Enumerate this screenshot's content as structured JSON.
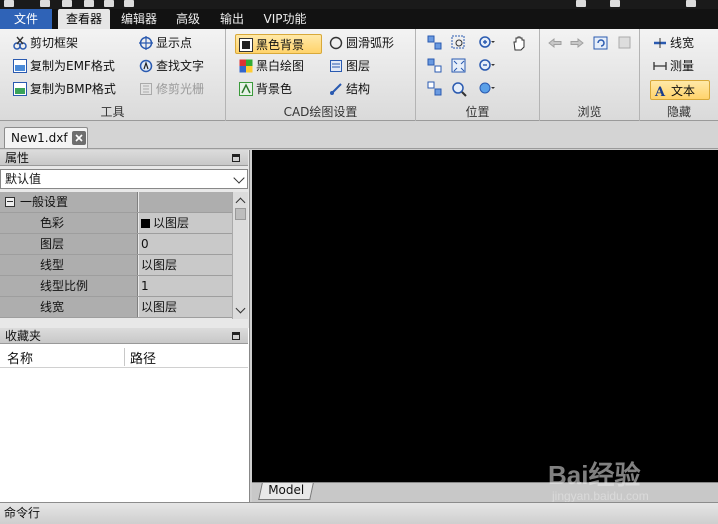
{
  "menu": {
    "file": "文件",
    "viewer": "查看器",
    "editor": "编辑器",
    "advanced": "高级",
    "output": "输出",
    "vip": "VIP功能"
  },
  "ribbon": {
    "tools": {
      "label": "工具",
      "clip_frame": "剪切框架",
      "copy_emf": "复制为EMF格式",
      "copy_bmp": "复制为BMP格式",
      "show_points": "显示点",
      "find_text": "查找文字",
      "trim_raster": "修剪光栅"
    },
    "cad_settings": {
      "label": "CAD绘图设置",
      "black_background": "黑色背景",
      "black_white": "黑白绘图",
      "background_color": "背景色",
      "smooth_arc": "圆滑弧形",
      "layers": "图层",
      "structure": "结构"
    },
    "position": {
      "label": "位置"
    },
    "browse": {
      "label": "浏览"
    },
    "hide": {
      "label": "隐藏",
      "line_width": "线宽",
      "measure": "测量",
      "text": "文本"
    }
  },
  "document_tab": {
    "name": "New1.dxf"
  },
  "properties": {
    "title": "属性",
    "preset": "默认值",
    "section": "一般设置",
    "rows": [
      {
        "key": "色彩",
        "value": "以图层"
      },
      {
        "key": "图层",
        "value": "0"
      },
      {
        "key": "线型",
        "value": "以图层"
      },
      {
        "key": "线型比例",
        "value": "1"
      },
      {
        "key": "线宽",
        "value": "以图层"
      }
    ]
  },
  "favorites": {
    "title": "收藏夹",
    "col_name": "名称",
    "col_path": "路径"
  },
  "model_tab": "Model",
  "command_line": "命令行",
  "watermark": {
    "brand": "Bai经验",
    "url": "jingyan.baidu.com"
  },
  "colors": {
    "menubar": "#121212",
    "file_menu": "#2f63b7",
    "canvas": "#000000",
    "highlight": "#ffd36b"
  }
}
